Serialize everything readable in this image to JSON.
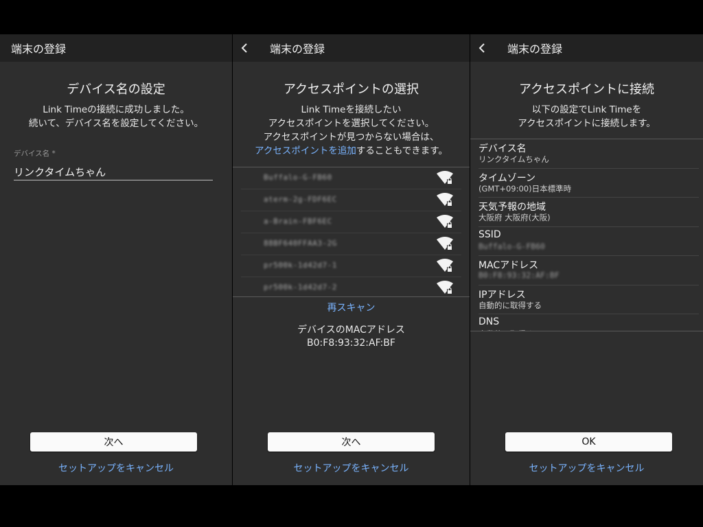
{
  "common": {
    "appbar_title": "端末の登録",
    "cancel_label": "セットアップをキャンセル"
  },
  "screen1": {
    "heading": "デバイス名の設定",
    "message_line1": "Link Timeの接続に成功しました。",
    "message_line2": "続いて、デバイス名を設定してください。",
    "field_label": "デバイス名 *",
    "field_value": "リンクタイムちゃん",
    "next_label": "次へ"
  },
  "screen2": {
    "heading": "アクセスポイントの選択",
    "message_line1": "Link Timeを接続したい",
    "message_line2": "アクセスポイントを選択してください。",
    "message_line3": "アクセスポイントが見つからない場合は、",
    "add_ap_link": "アクセスポイントを追加",
    "message_line4_suffix": "することもできます。",
    "access_points": [
      {
        "ssid": "Buffalo-G-FB60",
        "icon": "wifi-locked-icon"
      },
      {
        "ssid": "aterm-2g-FDF6EC",
        "icon": "wifi-locked-icon"
      },
      {
        "ssid": "a-Brain-FBF6EC",
        "icon": "wifi-locked-icon"
      },
      {
        "ssid": "88BF640FFAA3-2G",
        "icon": "wifi-locked-icon"
      },
      {
        "ssid": "pr500k-1d42d7-1",
        "icon": "wifi-locked-icon"
      },
      {
        "ssid": "pr500k-1d42d7-2",
        "icon": "wifi-locked-icon"
      }
    ],
    "rescan_label": "再スキャン",
    "mac_label": "デバイスのMACアドレス",
    "mac_value": "B0:F8:93:32:AF:BF",
    "next_label": "次へ"
  },
  "screen3": {
    "heading": "アクセスポイントに接続",
    "message_line1": "以下の設定でLink Timeを",
    "message_line2": "アクセスポイントに接続します。",
    "settings": [
      {
        "title": "デバイス名",
        "value": "リンクタイムちゃん",
        "blurred": false
      },
      {
        "title": "タイムゾーン",
        "value": "(GMT+09:00)日本標準時",
        "blurred": false
      },
      {
        "title": "天気予報の地域",
        "value": "大阪府 大阪府(大阪)",
        "blurred": false
      },
      {
        "title": "SSID",
        "value": "Buffalo-G-FB60",
        "blurred": true
      },
      {
        "title": "MACアドレス",
        "value": "B0:F8:93:32:AF:BF",
        "blurred": true
      },
      {
        "title": "IPアドレス",
        "value": "自動的に取得する",
        "blurred": false
      },
      {
        "title": "DNS",
        "value": "自動的に取得する",
        "blurred": false
      }
    ],
    "ok_label": "OK"
  },
  "colors": {
    "panel_bg": "#2e2e2e",
    "appbar_bg": "#222222",
    "link": "#7ab4ff",
    "button_bg": "#fafafa"
  }
}
